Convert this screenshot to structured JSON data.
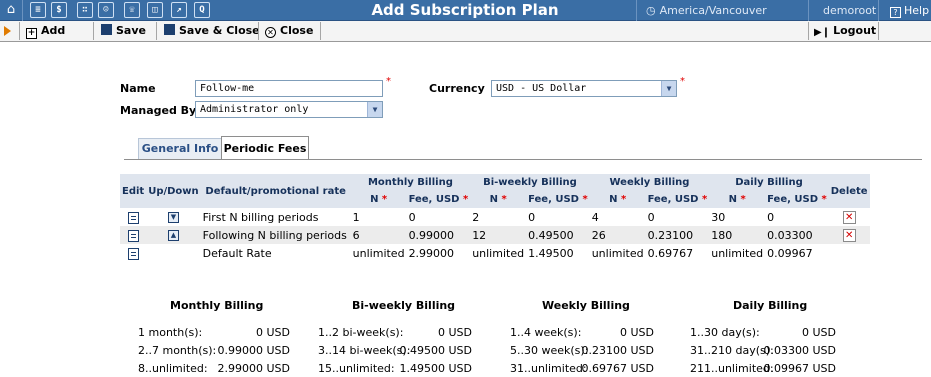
{
  "topbar": {
    "title": "Add Subscription Plan",
    "timezone": "America/Vancouver",
    "user": "demoroot",
    "help": "Help",
    "icons": [
      "home-icon",
      "list-icon",
      "dollar-icon",
      "grid-icon",
      "person-icon",
      "phone-icon",
      "cards-icon",
      "graph-icon",
      "search-icon"
    ]
  },
  "toolbar": {
    "add": "Add",
    "save": "Save",
    "save_close": "Save & Close",
    "close": "Close",
    "logout": "Logout"
  },
  "form": {
    "name_label": "Name",
    "name_value": "Follow-me",
    "currency_label": "Currency",
    "currency_value": "USD - US Dollar",
    "managed_by_label": "Managed By",
    "managed_by_value": "Administrator only",
    "required_mark": "*"
  },
  "tabs": {
    "general": "General Info",
    "periodic": "Periodic Fees"
  },
  "fees_table": {
    "col_edit": "Edit",
    "col_updown": "Up/Down",
    "col_rate": "Default/promotional rate",
    "col_delete": "Delete",
    "groups": [
      "Monthly Billing",
      "Bi-weekly Billing",
      "Weekly Billing",
      "Daily Billing"
    ],
    "sub_n": "N",
    "sub_fee": "Fee, USD",
    "star": "*",
    "rows": [
      {
        "label": "First N billing periods",
        "monthly_n": "1",
        "monthly_fee": "0",
        "biweekly_n": "2",
        "biweekly_fee": "0",
        "weekly_n": "4",
        "weekly_fee": "0",
        "daily_n": "30",
        "daily_fee": "0"
      },
      {
        "label": "Following N billing periods",
        "monthly_n": "6",
        "monthly_fee": "0.99000",
        "biweekly_n": "12",
        "biweekly_fee": "0.49500",
        "weekly_n": "26",
        "weekly_fee": "0.23100",
        "daily_n": "180",
        "daily_fee": "0.03300"
      },
      {
        "label": "Default Rate",
        "monthly_n": "unlimited",
        "monthly_fee": "2.99000",
        "biweekly_n": "unlimited",
        "biweekly_fee": "1.49500",
        "weekly_n": "unlimited",
        "weekly_fee": "0.69767",
        "daily_n": "unlimited",
        "daily_fee": "0.09967"
      }
    ]
  },
  "summary": {
    "headers": [
      "Monthly Billing",
      "Bi-weekly Billing",
      "Weekly Billing",
      "Daily Billing"
    ],
    "monthly": [
      {
        "period": "1 month(s):",
        "value": "0 USD"
      },
      {
        "period": "2..7 month(s):",
        "value": "0.99000 USD"
      },
      {
        "period": "8..unlimited:",
        "value": "2.99000 USD"
      }
    ],
    "biweekly": [
      {
        "period": "1..2 bi-week(s):",
        "value": "0 USD"
      },
      {
        "period": "3..14 bi-week(s):",
        "value": "0.49500 USD"
      },
      {
        "period": "15..unlimited:",
        "value": "1.49500 USD"
      }
    ],
    "weekly": [
      {
        "period": "1..4 week(s):",
        "value": "0 USD"
      },
      {
        "period": "5..30 week(s):",
        "value": "0.23100 USD"
      },
      {
        "period": "31..unlimited:",
        "value": "0.69767 USD"
      }
    ],
    "daily": [
      {
        "period": "1..30 day(s):",
        "value": "0 USD"
      },
      {
        "period": "31..210 day(s):",
        "value": "0.03300 USD"
      },
      {
        "period": "211..unlimited:",
        "value": "0.09967 USD"
      }
    ]
  },
  "colors": {
    "topbar_bg": "#3a6ea5",
    "toolbar_bg": "#f4f4f4",
    "header_cell_bg": "#dfe5ee",
    "required": "#e00000",
    "tab_text": "#2a4f85"
  }
}
